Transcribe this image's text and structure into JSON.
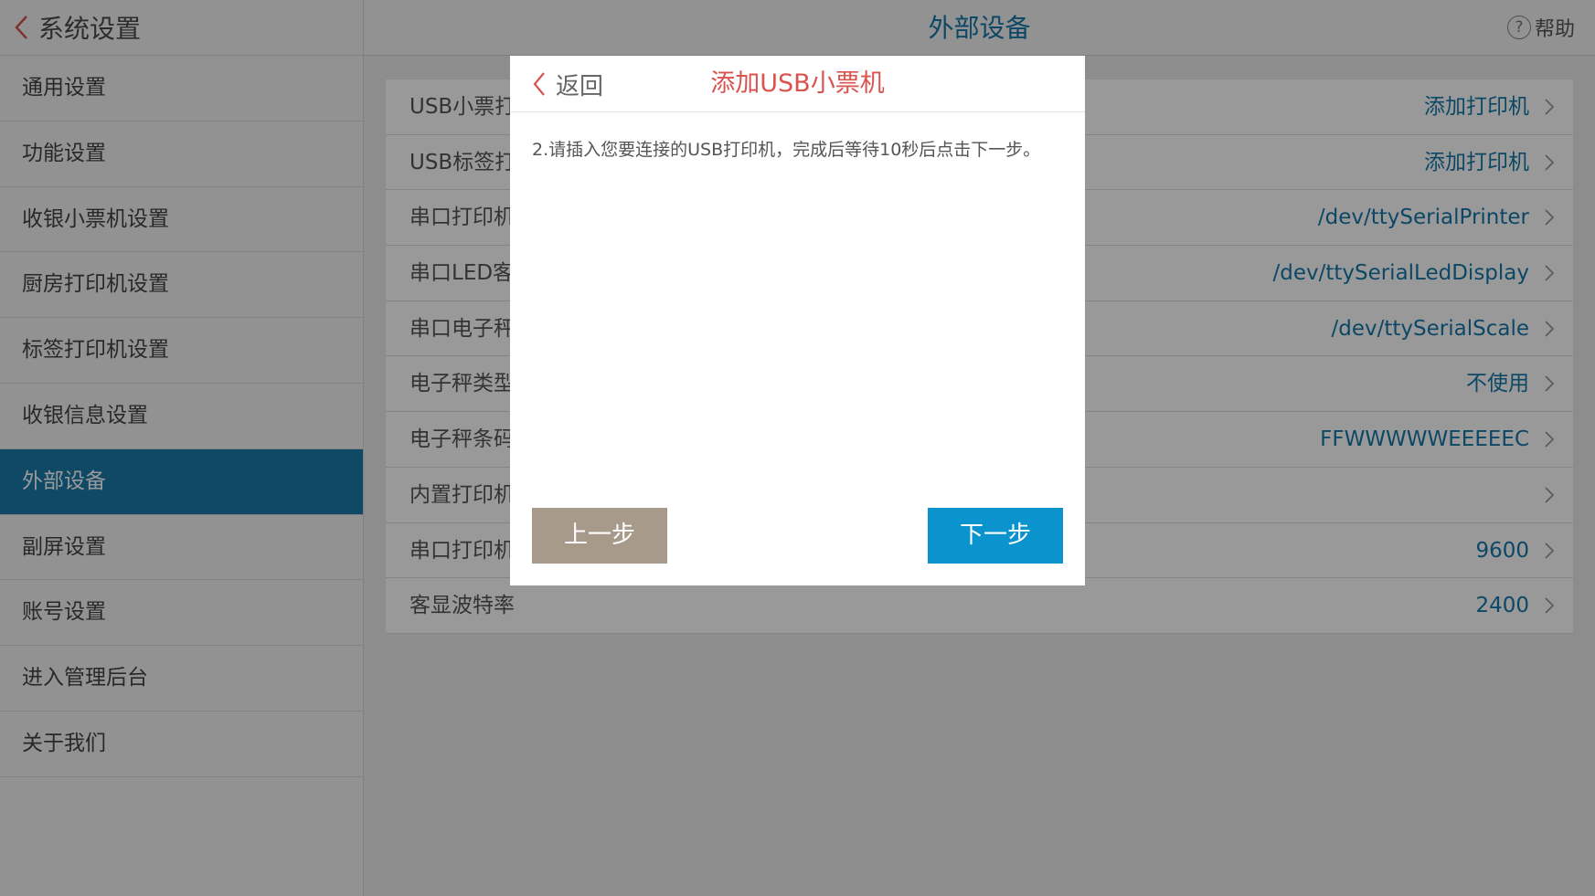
{
  "header": {
    "back_label": "系统设置",
    "title": "外部设备",
    "help_label": "帮助",
    "help_symbol": "?"
  },
  "sidebar": {
    "items": [
      {
        "label": "通用设置"
      },
      {
        "label": "功能设置"
      },
      {
        "label": "收银小票机设置"
      },
      {
        "label": "厨房打印机设置"
      },
      {
        "label": "标签打印机设置"
      },
      {
        "label": "收银信息设置"
      },
      {
        "label": "外部设备",
        "active": true
      },
      {
        "label": "副屏设置"
      },
      {
        "label": "账号设置"
      },
      {
        "label": "进入管理后台"
      },
      {
        "label": "关于我们"
      }
    ]
  },
  "settings": {
    "rows": [
      {
        "name": "USB小票打",
        "value": "添加打印机"
      },
      {
        "name": "USB标签打",
        "value": "添加打印机"
      },
      {
        "name": "串口打印机",
        "value": "/dev/ttySerialPrinter"
      },
      {
        "name": "串口LED客",
        "value": "/dev/ttySerialLedDisplay"
      },
      {
        "name": "串口电子秤",
        "value": "/dev/ttySerialScale"
      },
      {
        "name": "电子秤类型",
        "value": "不使用"
      },
      {
        "name": "电子秤条码",
        "value": "FFWWWWWEEEEEC"
      },
      {
        "name": "内置打印机",
        "value": ""
      },
      {
        "name": "串口打印机",
        "value": "9600"
      },
      {
        "name": "客显波特率",
        "value": "2400"
      }
    ]
  },
  "dialog": {
    "back_label": "返回",
    "title": "添加USB小票机",
    "message": "2.请插入您要连接的USB打印机，完成后等待10秒后点击下一步。",
    "prev_label": "上一步",
    "next_label": "下一步"
  },
  "colors": {
    "accent_blue": "#1478a8",
    "active_sidebar": "#1a7aa8",
    "dialog_title_red": "#d9534f",
    "prev_button": "#a89a8b",
    "next_button": "#0a93cc"
  },
  "icons": {
    "header_back": "chevron-left-icon",
    "help": "help-circle-icon",
    "row_arrow": "chevron-right-icon",
    "dialog_back": "chevron-left-icon"
  }
}
